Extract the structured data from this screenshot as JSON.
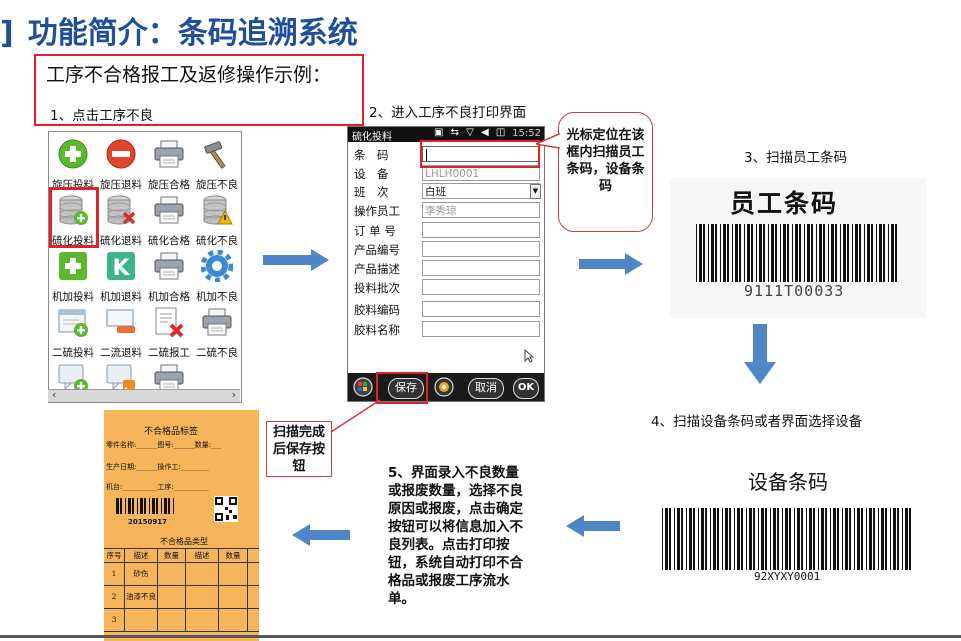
{
  "title": {
    "bracket": "]",
    "text": "功能简介：条码追溯系统"
  },
  "subtitle": "工序不合格报工及返修操作示例：",
  "steps": {
    "s1": "1、点击工序不良",
    "s2": "2、进入工序不良打印界面",
    "s3": "3、扫描员工条码",
    "s4": "4、扫描设备条码或者界面选择设备",
    "s5": "5、界面录入不良数量或报废数量，选择不良原因或报废，点击确定按钮可以将信息加入不良列表。点击打印按钮，系统自动打印不合格品或报废工序流水单。"
  },
  "menu": {
    "items": [
      {
        "label": "旋压投料",
        "icon": "plus-circle-icon"
      },
      {
        "label": "旋压退料",
        "icon": "minus-circle-icon"
      },
      {
        "label": "旋压合格",
        "icon": "printer-icon"
      },
      {
        "label": "旋压不良",
        "icon": "hammer-icon"
      },
      {
        "label": "硫化投料",
        "icon": "database-plus-icon"
      },
      {
        "label": "硫化退料",
        "icon": "database-x-icon"
      },
      {
        "label": "硫化合格",
        "icon": "printer-icon"
      },
      {
        "label": "硫化不良",
        "icon": "database-warning-icon"
      },
      {
        "label": "机加投料",
        "icon": "plus-square-icon"
      },
      {
        "label": "机加退料",
        "icon": "k-square-icon"
      },
      {
        "label": "机加合格",
        "icon": "printer-icon"
      },
      {
        "label": "机加不良",
        "icon": "gear-icon"
      },
      {
        "label": "二硫投料",
        "icon": "window-plus-icon"
      },
      {
        "label": "二流退料",
        "icon": "window-minus-icon"
      },
      {
        "label": "二硫报工",
        "icon": "doc-x-icon"
      },
      {
        "label": "二硫不良",
        "icon": "printer-icon"
      },
      {
        "label": "",
        "icon": "chat-plus-icon"
      },
      {
        "label": "",
        "icon": "chat-rss-icon"
      },
      {
        "label": "",
        "icon": "printer-icon"
      }
    ]
  },
  "form": {
    "app_name": "硫化投料",
    "time": "15:52",
    "fields": [
      {
        "label": "条　码",
        "value": "",
        "placeholder": ""
      },
      {
        "label": "设　备",
        "value": "LHLH0001",
        "placeholder": ""
      },
      {
        "label": "班　次",
        "value": "白班",
        "placeholder": ""
      },
      {
        "label": "操作员工",
        "value": "李秀琼",
        "placeholder": ""
      },
      {
        "label": "订 单 号",
        "value": "",
        "placeholder": ""
      },
      {
        "label": "产品编号",
        "value": "",
        "placeholder": ""
      },
      {
        "label": "产品描述",
        "value": "",
        "placeholder": ""
      },
      {
        "label": "投料批次",
        "value": "",
        "placeholder": ""
      },
      {
        "label": "胶料编码",
        "value": "",
        "placeholder": ""
      },
      {
        "label": "胶料名称",
        "value": "",
        "placeholder": ""
      }
    ],
    "buttons": {
      "save": "保存",
      "cancel": "取消",
      "ok": "OK"
    }
  },
  "callouts": {
    "cursor": "光标定位在该框内扫描员工条码，设备条码",
    "save": "扫描完成后保存按钮"
  },
  "barcodes": {
    "employee": {
      "label": "员工条码",
      "number": "9111T00033"
    },
    "device": {
      "label": "设备条码",
      "number": "92XYXY0001"
    }
  },
  "sheet": {
    "title": "不合格品标签",
    "row1": "零件名称:______图号:______数量:___",
    "row2": "生产日期:______操作工:________",
    "row3": "机台:__________工序:__________",
    "barcode_number": "20150917",
    "type_title": "不合格品类型",
    "columns": [
      "序号",
      "描述",
      "数量",
      "描述",
      "数量"
    ],
    "rows": [
      [
        "1",
        "砂伤"
      ],
      [
        "2",
        "油漆不良"
      ],
      [
        "3",
        ""
      ]
    ]
  },
  "colors": {
    "title": "#1f4e9c",
    "highlight": "#e0202a",
    "arrow": "#4f86c6",
    "sheet": "#f6b55b"
  }
}
